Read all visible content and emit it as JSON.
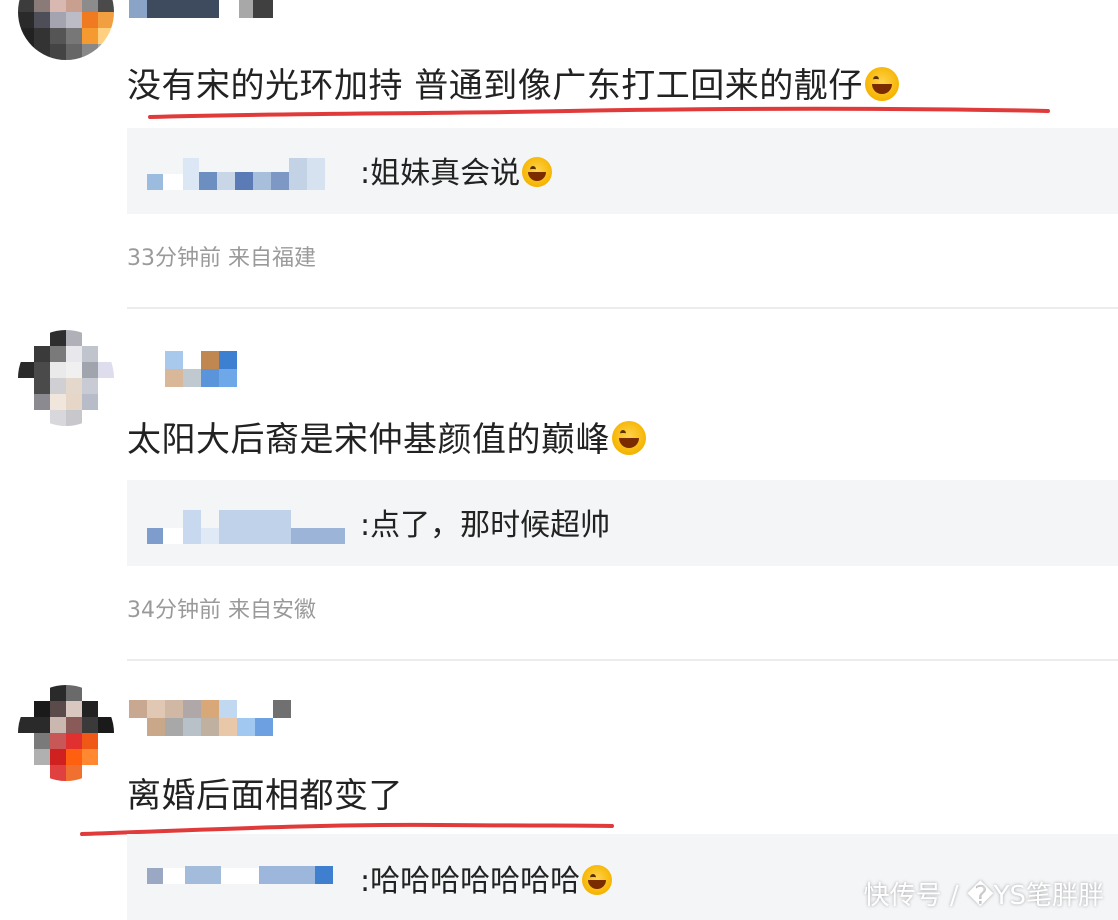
{
  "comments": [
    {
      "text": "没有宋的光环加持 普通到像广东打工回来的靓仔",
      "emoji_icon": "laugh-cry-emoji",
      "reply": {
        "text": ":姐妹真会说",
        "emoji_icon": "laugh-cry-emoji"
      },
      "meta": "33分钟前 来自福建",
      "underline_color": "#e03a3a"
    },
    {
      "text": "太阳大后裔是宋仲基颜值的巅峰",
      "emoji_icon": "grin-emoji",
      "reply": {
        "text": ":点了，那时候超帅"
      },
      "meta": "34分钟前 来自安徽"
    },
    {
      "text": "离婚后面相都变了",
      "reply": {
        "text": ":哈哈哈哈哈哈哈",
        "emoji_icon": "laugh-cry-emoji"
      },
      "underline_color": "#e03a3a"
    }
  ],
  "watermark": "快传号 / �YS笔胖胖"
}
